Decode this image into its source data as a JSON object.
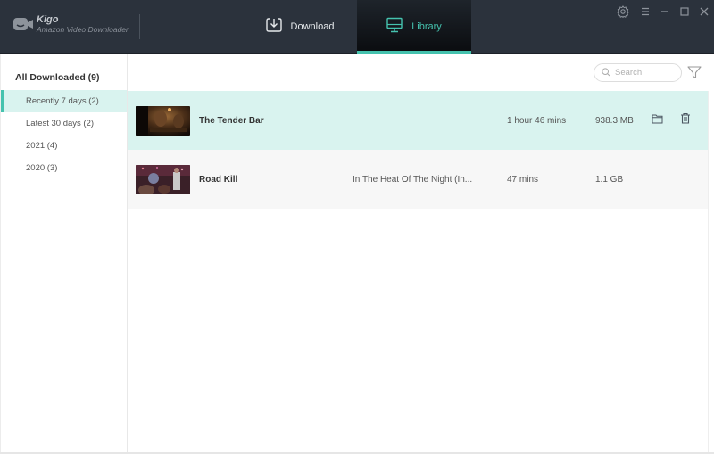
{
  "app": {
    "name": "Kigo",
    "subtitle": "Amazon Video Downloader"
  },
  "nav": {
    "tabs": [
      {
        "label": "Download",
        "icon": "download-icon",
        "active": false
      },
      {
        "label": "Library",
        "icon": "monitor-icon",
        "active": true
      }
    ]
  },
  "window_controls": [
    "gear-icon",
    "menu-icon",
    "minimize-icon",
    "maximize-icon",
    "close-icon"
  ],
  "sidebar": {
    "header": "All Downloaded (9)",
    "items": [
      {
        "label": "Recently 7 days (2)",
        "active": true
      },
      {
        "label": "Latest 30 days (2)",
        "active": false
      },
      {
        "label": "2021 (4)",
        "active": false
      },
      {
        "label": "2020 (3)",
        "active": false
      }
    ]
  },
  "search": {
    "placeholder": "Search",
    "value": ""
  },
  "colors": {
    "accent": "#45c2ae",
    "titlebar": "#2b323c",
    "selected_row": "#d9f3ef"
  },
  "videos": [
    {
      "title": "The Tender Bar",
      "series": "",
      "duration": "1 hour 46 mins",
      "size": "938.3 MB",
      "selected": true,
      "actions": [
        "folder-icon",
        "trash-icon"
      ]
    },
    {
      "title": "Road Kill",
      "series": "In The Heat Of The Night (In...",
      "duration": "47 mins",
      "size": "1.1 GB",
      "selected": false,
      "actions": []
    }
  ]
}
